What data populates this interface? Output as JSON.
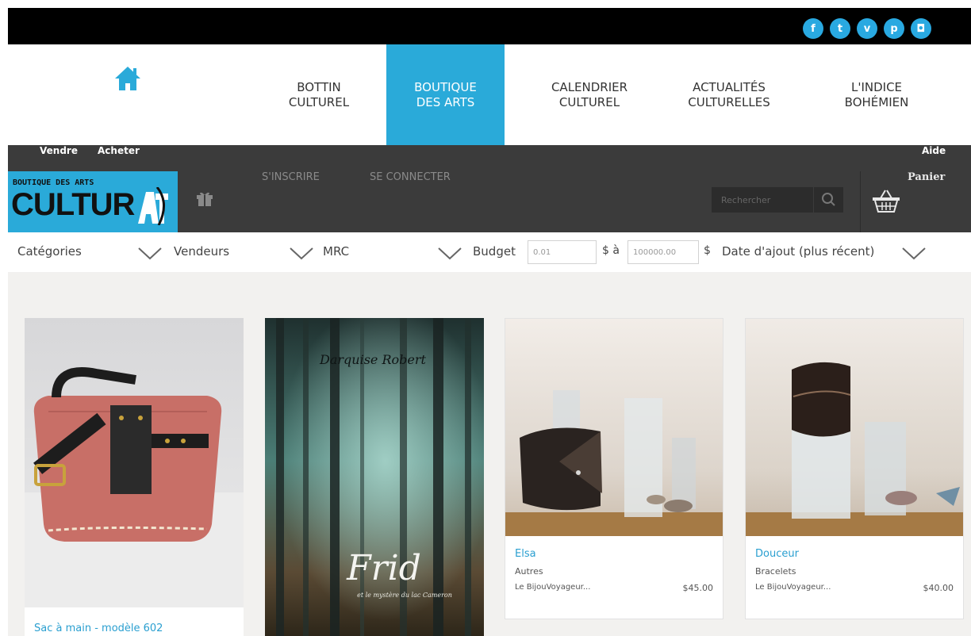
{
  "social": [
    {
      "glyph": "f",
      "icon": "facebook-icon"
    },
    {
      "glyph": "t",
      "icon": "twitter-icon"
    },
    {
      "glyph": "v",
      "icon": "vimeo-icon"
    },
    {
      "glyph": "p",
      "icon": "pinterest-icon"
    },
    {
      "glyph": "◘",
      "icon": "instagram-icon"
    }
  ],
  "nav": {
    "items": [
      {
        "line1": "BOTTIN",
        "line2": "CULTUREL"
      },
      {
        "line1": "BOUTIQUE",
        "line2": "DES ARTS"
      },
      {
        "line1": "CALENDRIER",
        "line2": "CULTUREL"
      },
      {
        "line1": "ACTUALITÉS",
        "line2": "CULTURELLES"
      },
      {
        "line1": "L'INDICE",
        "line2": "BOHÉMIEN"
      }
    ],
    "active_index": 1
  },
  "subnav": {
    "sell": "Vendre",
    "buy": "Acheter",
    "help": "Aide"
  },
  "shop": {
    "logo_small": "BOUTIQUE DES ARTS",
    "logo_big": "CULTUR",
    "logo_at": "AT",
    "signup": "S'INSCRIRE",
    "login": "SE CONNECTER",
    "search_placeholder": "Rechercher",
    "cart": "Panier"
  },
  "filters": {
    "categories": "Catégories",
    "vendors": "Vendeurs",
    "mrc": "MRC",
    "budget_label": "Budget",
    "budget_min": "0.01",
    "currency_to": "$ à",
    "budget_max": "100000.00",
    "currency": "$",
    "sort": "Date d'ajout (plus récent)"
  },
  "products": [
    {
      "title": "Sac à main - modèle 602"
    },
    {
      "cover_author": "Darquise Robert",
      "cover_title": "Frid",
      "cover_subtitle": "et le mystère du lac Cameron"
    },
    {
      "title": "Elsa",
      "category": "Autres",
      "seller": "Le BijouVoyageur...",
      "price": "$45.00"
    },
    {
      "title": "Douceur",
      "category": "Bracelets",
      "seller": "Le BijouVoyageur...",
      "price": "$40.00"
    }
  ],
  "colors": {
    "accent": "#2aaad9",
    "dark_bar": "#3b3b3b",
    "link": "#2a9fd0"
  }
}
